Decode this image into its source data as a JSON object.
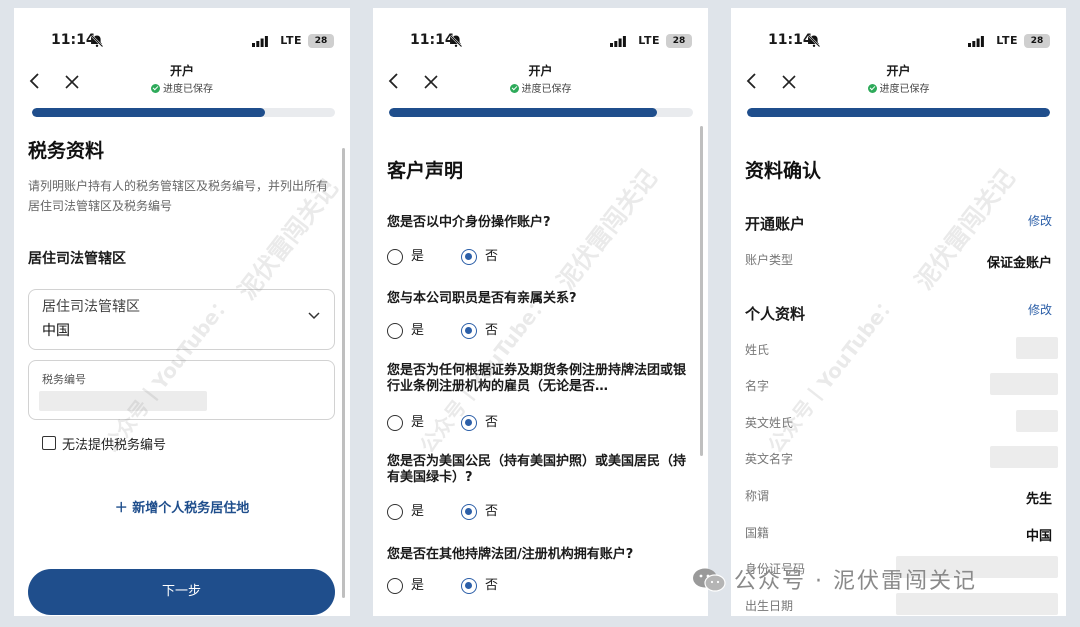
{
  "status": {
    "time": "11:14",
    "network": "LTE",
    "battery": "28"
  },
  "nav": {
    "title": "开户",
    "saved": "进度已保存"
  },
  "panel1": {
    "heading": "税务资料",
    "description": "请列明账户持有人的税务管辖区及税务编号，并列出所有居住司法管辖区及税务编号",
    "subheading": "居住司法管辖区",
    "jurisdiction_label": "居住司法管辖区",
    "jurisdiction_value": "中国",
    "tax_label": "税务编号",
    "no_tax_label": "无法提供税务编号",
    "add_label": "＋ 新增个人税务居住地",
    "next_label": "下一步",
    "progress": 0.77
  },
  "panel2": {
    "heading": "客户声明",
    "progress": 0.88,
    "yes": "是",
    "no": "否",
    "questions": [
      {
        "text": "您是否以中介身份操作账户?",
        "selected": "no"
      },
      {
        "text": "您与本公司职员是否有亲属关系?",
        "selected": "no"
      },
      {
        "text": "您是否为任何根据证券及期货条例注册持牌法团或银行业条例注册机构的雇员（无论是否…",
        "selected": "no"
      },
      {
        "text": "您是否为美国公民（持有美国护照）或美国居民（持有美国绿卡）?",
        "selected": "no"
      },
      {
        "text": "您是否在其他持牌法团/注册机构拥有账户?",
        "selected": "no"
      }
    ]
  },
  "panel3": {
    "heading": "资料确认",
    "progress": 1.0,
    "edit_label": "修改",
    "section_account": "开通账户",
    "account_type_label": "账户类型",
    "account_type_value": "保证金账户",
    "section_personal": "个人资料",
    "fields": [
      {
        "label": "姓氏",
        "value": ""
      },
      {
        "label": "名字",
        "value": ""
      },
      {
        "label": "英文姓氏",
        "value": ""
      },
      {
        "label": "英文名字",
        "value": ""
      },
      {
        "label": "称谓",
        "value": "先生"
      },
      {
        "label": "国籍",
        "value": "中国"
      },
      {
        "label": "身份证号码",
        "value": ""
      },
      {
        "label": "出生日期",
        "value": ""
      }
    ]
  },
  "watermark": {
    "diagonal": "泥伏雷闯关记",
    "diagonal2": "公众号丨YouTube：",
    "footer": "公众号 · 泥伏雷闯关记"
  },
  "colors": {
    "primary": "#1f4e8c",
    "link": "#2c5fa8",
    "ok": "#2eaa5a"
  }
}
